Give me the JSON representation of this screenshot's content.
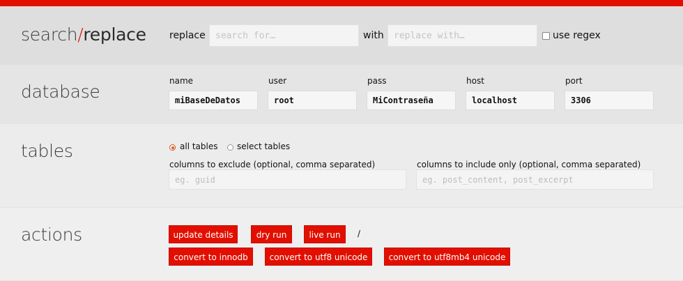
{
  "colors": {
    "accent": "#e20f00"
  },
  "search_section": {
    "title_part1": "search",
    "title_slash": "/",
    "title_part2": "replace",
    "replace_label": "replace",
    "search_placeholder": "search for…",
    "with_label": "with",
    "replace_placeholder": "replace with…",
    "regex_label": "use regex"
  },
  "database_section": {
    "title": "database",
    "name_label": "name",
    "name_value": "miBaseDeDatos",
    "user_label": "user",
    "user_value": "root",
    "pass_label": "pass",
    "pass_value": "MiContraseña",
    "host_label": "host",
    "host_value": "localhost",
    "port_label": "port",
    "port_value": "3306"
  },
  "tables_section": {
    "title": "tables",
    "all_tables_label": "all tables",
    "select_tables_label": "select tables",
    "exclude_label": "columns to exclude (optional, comma separated)",
    "exclude_placeholder": "eg. guid",
    "include_label": "columns to include only (optional, comma separated)",
    "include_placeholder": "eg. post_content, post_excerpt"
  },
  "actions_section": {
    "title": "actions",
    "update_details": "update details",
    "dry_run": "dry run",
    "live_run": "live run",
    "separator": "/",
    "convert_innodb": "convert to innodb",
    "convert_utf8": "convert to utf8 unicode",
    "convert_utf8mb4": "convert to utf8mb4 unicode"
  }
}
